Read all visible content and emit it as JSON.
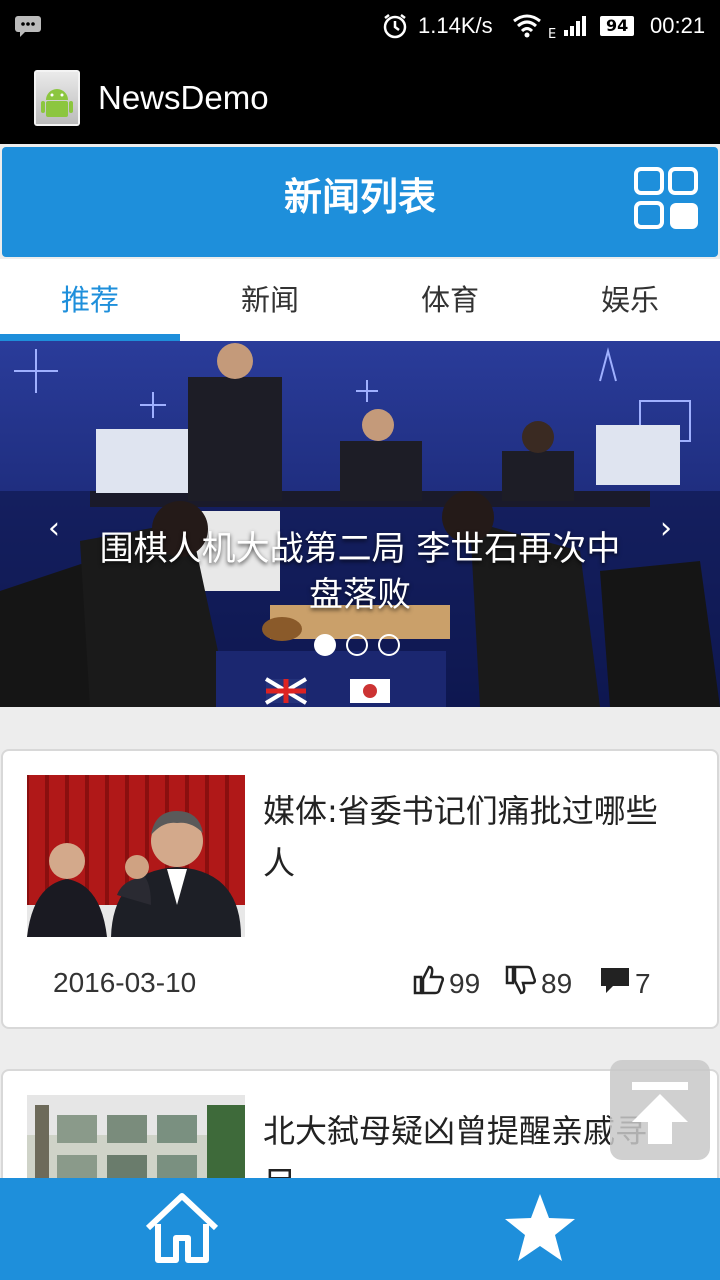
{
  "status_bar": {
    "speed": "1.14K/s",
    "network_type": "E",
    "battery": "94",
    "time": "00:21"
  },
  "app": {
    "title": "NewsDemo"
  },
  "header": {
    "title": "新闻列表"
  },
  "tabs": [
    {
      "label": "推荐",
      "active": true
    },
    {
      "label": "新闻",
      "active": false
    },
    {
      "label": "体育",
      "active": false
    },
    {
      "label": "娱乐",
      "active": false
    }
  ],
  "banner": {
    "caption": "围棋人机大战第二局 李世石再次中盘落败",
    "slide_count": 3,
    "active_slide": 1
  },
  "news": [
    {
      "title": "媒体:省委书记们痛批过哪些人",
      "date": "2016-03-10",
      "likes": "99",
      "dislikes": "89",
      "comments": "7"
    },
    {
      "title": "北大弑母疑凶曾提醒亲戚寻尸"
    }
  ],
  "colors": {
    "accent": "#1e8fdb"
  }
}
